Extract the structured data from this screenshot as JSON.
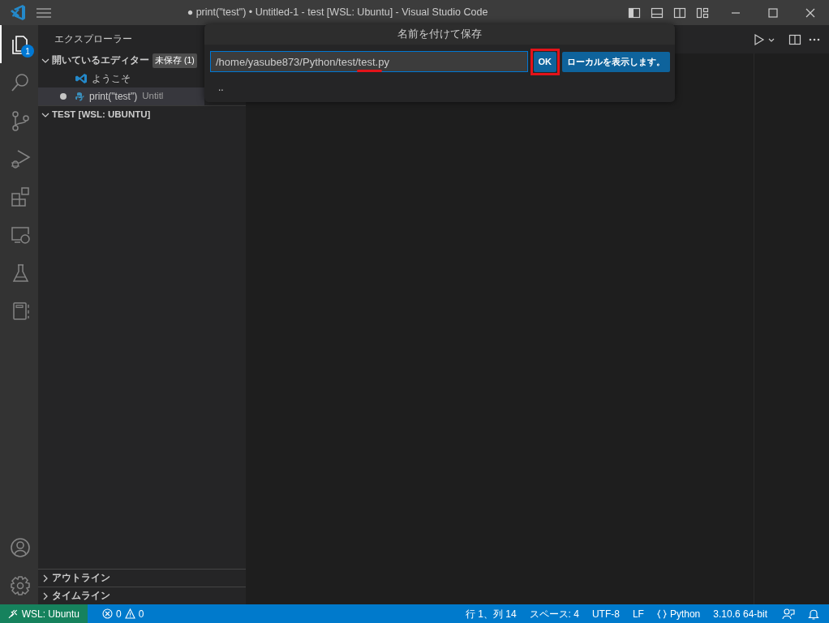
{
  "window": {
    "title": "● print(\"test\") • Untitled-1 - test [WSL: Ubuntu] - Visual Studio Code"
  },
  "activity_bar": {
    "items": [
      {
        "kind": "explorer",
        "selected": true,
        "badge": "1"
      },
      {
        "kind": "search",
        "selected": false
      },
      {
        "kind": "source_control",
        "selected": false
      },
      {
        "kind": "run_debug",
        "selected": false
      },
      {
        "kind": "extensions",
        "selected": false
      },
      {
        "kind": "remote",
        "selected": false
      },
      {
        "kind": "testing",
        "selected": false
      },
      {
        "kind": "notebook",
        "selected": false
      }
    ],
    "bottom": [
      {
        "kind": "account"
      },
      {
        "kind": "settings"
      }
    ]
  },
  "sidebar": {
    "title": "エクスプローラー",
    "open_editors": {
      "label": "開いているエディター",
      "expanded": true,
      "badge": "未保存 (1)",
      "items": [
        {
          "kind": "welcome",
          "label": "ようこそ",
          "modified": false,
          "selected": false
        },
        {
          "kind": "python",
          "label": "print(\"test\")",
          "description": "Untitl",
          "modified": true,
          "selected": true
        }
      ]
    },
    "folder": {
      "label": "TEST [WSL: UBUNTU]",
      "expanded": true
    },
    "panels": [
      {
        "label": "アウトライン",
        "expanded": false
      },
      {
        "label": "タイムライン",
        "expanded": false
      }
    ]
  },
  "dialog": {
    "title": "名前を付けて保存",
    "value": "/home/yasube873/Python/test/test.py",
    "buttons": [
      "OK",
      "ローカルを表示します。"
    ],
    "items": [
      ".."
    ],
    "file_name_underlined": true,
    "ok_button_outlined": true
  },
  "status_bar": {
    "remote": "WSL: Ubuntu",
    "errors": "0",
    "warnings": "0",
    "items": [
      {
        "kind": "text",
        "label": "行 1、列 14"
      },
      {
        "kind": "text",
        "label": "スペース: 4"
      },
      {
        "kind": "text",
        "label": "UTF-8"
      },
      {
        "kind": "text",
        "label": "LF"
      },
      {
        "kind": "language",
        "label": "Python"
      },
      {
        "kind": "text",
        "label": "3.10.6 64-bit"
      },
      {
        "kind": "feedback"
      },
      {
        "kind": "bell"
      }
    ]
  }
}
